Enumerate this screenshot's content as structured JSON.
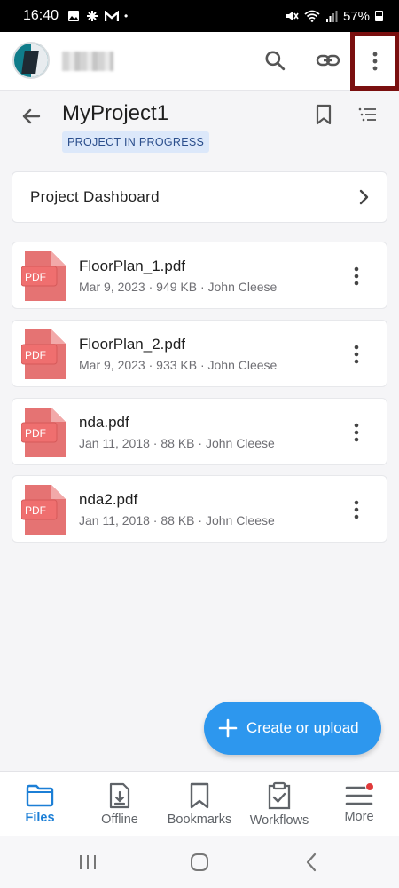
{
  "status_bar": {
    "time": "16:40",
    "battery": "57%"
  },
  "project": {
    "title": "MyProject1",
    "status": "PROJECT IN PROGRESS"
  },
  "dashboard": {
    "label": "Project Dashboard"
  },
  "files": [
    {
      "name": "FloorPlan_1.pdf",
      "meta": "Mar 9, 2023 · 949 KB · John Cleese",
      "icon": "pdf-icon",
      "icon_label": "PDF"
    },
    {
      "name": "FloorPlan_2.pdf",
      "meta": "Mar 9, 2023 · 933 KB · John Cleese",
      "icon": "pdf-icon",
      "icon_label": "PDF"
    },
    {
      "name": "nda.pdf",
      "meta": "Jan 11, 2018 · 88 KB · John Cleese",
      "icon": "pdf-icon",
      "icon_label": "PDF"
    },
    {
      "name": "nda2.pdf",
      "meta": "Jan 11, 2018 · 88 KB · John Cleese",
      "icon": "pdf-icon",
      "icon_label": "PDF"
    }
  ],
  "fab": {
    "label": "Create or upload"
  },
  "bottom_nav": [
    {
      "label": "Files",
      "icon": "folder-icon",
      "active": true
    },
    {
      "label": "Offline",
      "icon": "offline-download-icon",
      "active": false
    },
    {
      "label": "Bookmarks",
      "icon": "bookmark-icon",
      "active": false
    },
    {
      "label": "Workflows",
      "icon": "clipboard-check-icon",
      "active": false
    },
    {
      "label": "More",
      "icon": "menu-icon",
      "active": false,
      "badge": true
    }
  ],
  "colors": {
    "accent": "#2d97ee",
    "pdf_red": "#e57373",
    "chip_bg": "#dce8fa",
    "highlight_border": "#7a0f0f"
  }
}
